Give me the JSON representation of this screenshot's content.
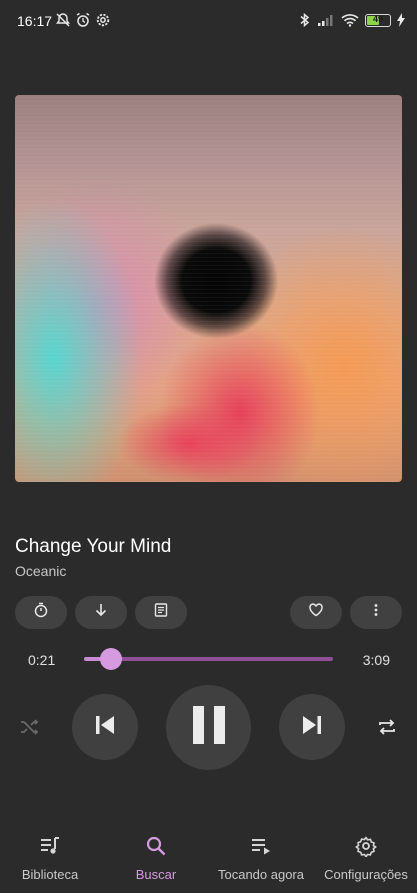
{
  "status_bar": {
    "time": "16:17",
    "battery_level": "49",
    "icons": [
      "mute-notifications-icon",
      "alarm-icon",
      "settings-icon",
      "bluetooth-icon",
      "signal-icon",
      "wifi-icon",
      "battery-icon",
      "charging-icon"
    ]
  },
  "track": {
    "title": "Change Your Mind",
    "artist": "Oceanic"
  },
  "actions": [
    "sleep-timer-icon",
    "download-icon",
    "lyrics-icon",
    "favorite-icon",
    "more-icon"
  ],
  "progress": {
    "elapsed": "0:21",
    "total": "3:09",
    "fraction": 0.11
  },
  "controls": [
    "shuffle-icon",
    "previous-icon",
    "pause-icon",
    "next-icon",
    "repeat-icon"
  ],
  "nav": {
    "items": [
      {
        "label": "Biblioteca",
        "icon": "library-icon",
        "active": false
      },
      {
        "label": "Buscar",
        "icon": "search-icon",
        "active": true
      },
      {
        "label": "Tocando agora",
        "icon": "now-playing-icon",
        "active": false
      },
      {
        "label": "Configurações",
        "icon": "gear-icon",
        "active": false
      }
    ]
  },
  "colors": {
    "background": "#2b2b2b",
    "accent": "#d59ae0",
    "progress_track": "#8e4f96",
    "button_bg": "#404040"
  }
}
